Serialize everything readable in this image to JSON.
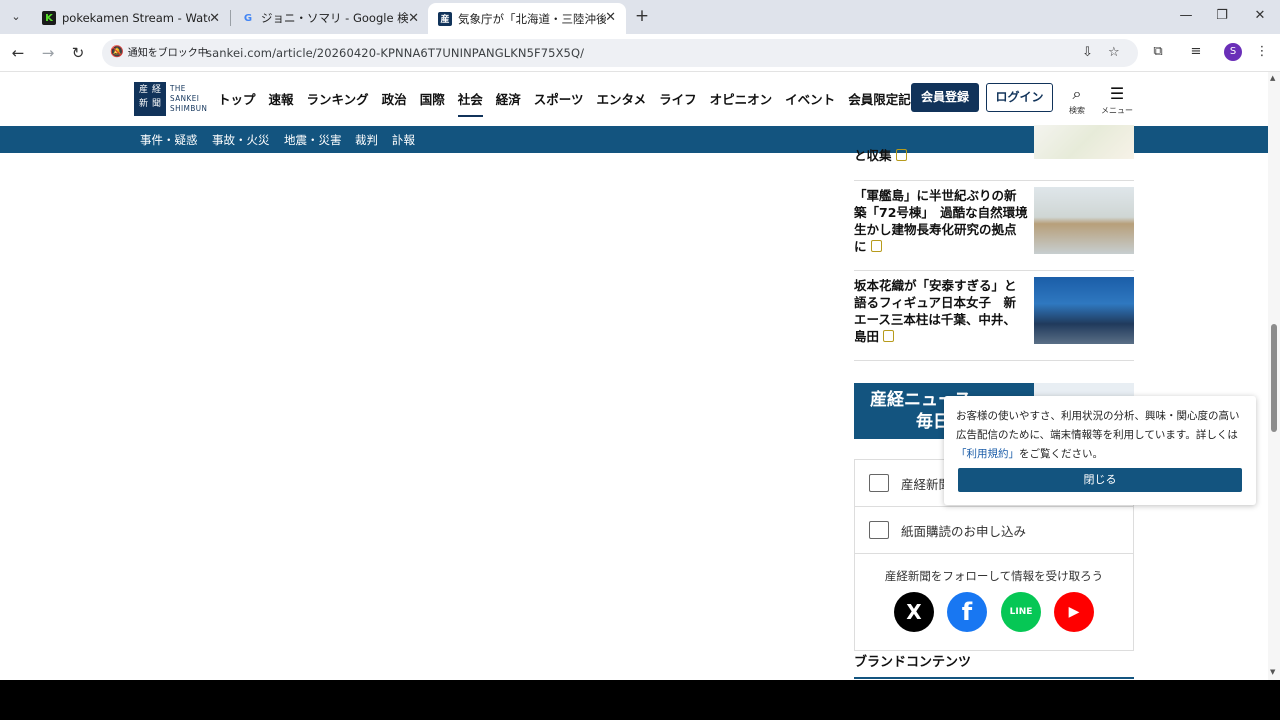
{
  "browser": {
    "tabs": [
      {
        "title": "pokekamen Stream - Watch Live",
        "favicon": "K"
      },
      {
        "title": "ジョニ・ソマリ - Google 検索",
        "favicon": "G"
      },
      {
        "title": "気象庁が「北海道・三陸沖後発地",
        "favicon": "産"
      }
    ],
    "notify_label": "通知をブロック中",
    "url": "sankei.com/article/20260420-KPNNA6T7UNINPANGLKN5F75X5Q/",
    "profile_initial": "S"
  },
  "site": {
    "logo_mark": [
      "産",
      "経",
      "新",
      "聞"
    ],
    "logo_text": [
      "THE",
      "SANKEI",
      "SHIMBUN"
    ],
    "nav": [
      "トップ",
      "速報",
      "ランキング",
      "政治",
      "国際",
      "社会",
      "経済",
      "スポーツ",
      "エンタメ",
      "ライフ",
      "オピニオン",
      "イベント",
      "会員限定記事"
    ],
    "nav_active": "社会",
    "member_button": "会員登録",
    "login_button": "ログイン",
    "search_label": "検索",
    "menu_label": "メニュー",
    "subnav": [
      "事件・疑惑",
      "事故・火災",
      "地震・災害",
      "裁判",
      "訃報"
    ]
  },
  "sidebar": {
    "articles": [
      {
        "title": "と収集"
      },
      {
        "title": "「軍艦島」に半世紀ぶりの新築「72号棟」　過酷な自然環境生かし建物長寿化研究の拠点に"
      },
      {
        "title": "坂本花織が「安泰すぎる」と語るフィギュア日本女子　新エース三本柱は千葉、中井、島田"
      }
    ],
    "banner_line1": "産経ニュース",
    "banner_line2": "毎日",
    "links": [
      "産経新聞",
      "紙面購読のお申し込み"
    ],
    "follow_text": "産経新聞をフォローして情報を受け取ろう",
    "sns": [
      "X",
      "f",
      "LINE",
      "▶"
    ],
    "brand_heading": "ブランドコンテンツ"
  },
  "consent": {
    "message_before": "お客様の使いやすさ、利用状況の分析、興味・関心度の高い広告配信のために、端末情報等を利用しています。詳しくは",
    "link_text": "「利用規約」",
    "message_after": "をご覧ください。",
    "close_label": "閉じる"
  },
  "colors": {
    "brand_navy": "#11335a",
    "subnav_blue": "#13547f",
    "lock_gold": "#b79b1c"
  }
}
